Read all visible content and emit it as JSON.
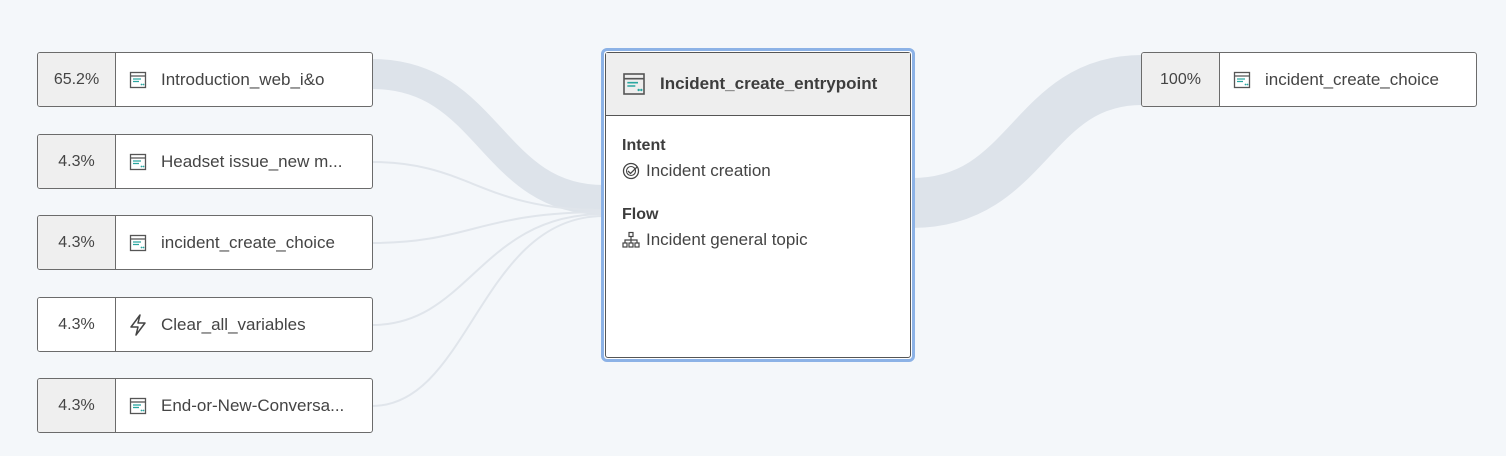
{
  "inputs": [
    {
      "percent": "65.2%",
      "label": "Introduction_web_i&o",
      "icon": "topic-node-icon"
    },
    {
      "percent": "4.3%",
      "label": "Headset issue_new m...",
      "icon": "topic-node-icon"
    },
    {
      "percent": "4.3%",
      "label": "incident_create_choice",
      "icon": "topic-node-icon"
    },
    {
      "percent": "4.3%",
      "label": "Clear_all_variables",
      "icon": "lightning-icon"
    },
    {
      "percent": "4.3%",
      "label": "End-or-New-Conversa...",
      "icon": "topic-node-icon"
    }
  ],
  "center": {
    "title": "Incident_create_entrypoint",
    "intent_caption": "Intent",
    "intent_value": "Incident creation",
    "flow_caption": "Flow",
    "flow_value": "Incident general topic"
  },
  "outputs": [
    {
      "percent": "100%",
      "label": "incident_create_choice",
      "icon": "topic-node-icon"
    }
  ],
  "colors": {
    "background": "#f4f7fa",
    "flow_band": "#dde3ea",
    "selected_border": "#8cb2e6",
    "icon_teal": "#2aa6a0"
  }
}
